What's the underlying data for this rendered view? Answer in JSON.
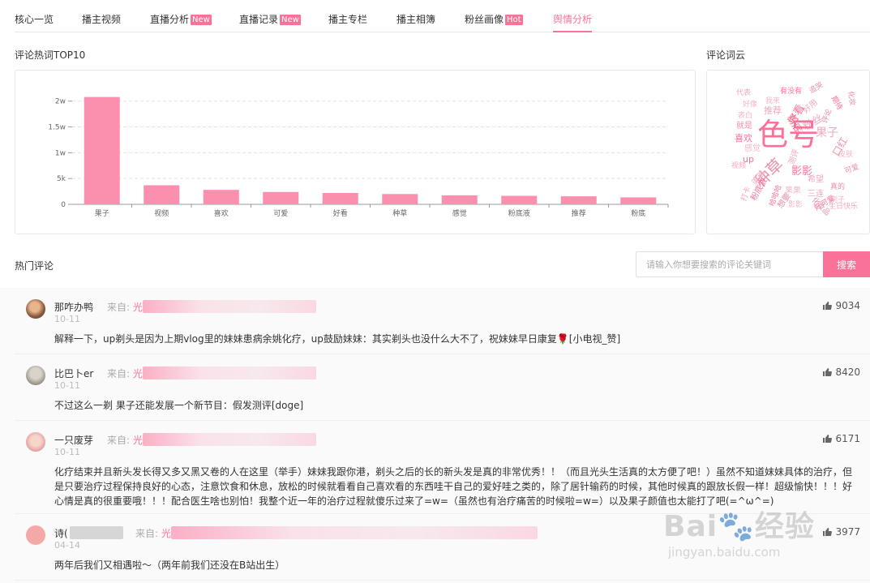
{
  "tabs": [
    {
      "label": "核心一览",
      "badge": ""
    },
    {
      "label": "播主视频",
      "badge": ""
    },
    {
      "label": "直播分析",
      "badge": "New"
    },
    {
      "label": "直播记录",
      "badge": "New"
    },
    {
      "label": "播主专栏",
      "badge": ""
    },
    {
      "label": "播主相簿",
      "badge": ""
    },
    {
      "label": "粉丝画像",
      "badge": "Hot"
    },
    {
      "label": "舆情分析",
      "badge": ""
    }
  ],
  "sections": {
    "top10": "评论热词TOP10",
    "cloud": "评论词云",
    "hot": "热门评论"
  },
  "chart_data": {
    "type": "bar",
    "title": "评论热词TOP10",
    "categories": [
      "果子",
      "视频",
      "喜欢",
      "可爱",
      "好看",
      "种草",
      "感觉",
      "粉底液",
      "推荐",
      "粉底"
    ],
    "values": [
      20800,
      3700,
      2800,
      2400,
      2200,
      2000,
      1750,
      1650,
      1550,
      1350
    ],
    "ylim": [
      0,
      22000
    ],
    "yticks": [
      0,
      5000,
      10000,
      15000,
      20000
    ],
    "ytick_labels": [
      "0",
      "5k",
      "1w",
      "1.5w",
      "2w"
    ],
    "grid": true,
    "colors": {
      "bar": "#fb8fae",
      "grid": "#e3e3e3",
      "axis": "#999"
    }
  },
  "word_cloud": [
    "代表",
    "有没有",
    "追哭",
    "我来",
    "好用",
    "期待",
    "化妆",
    "好像",
    "推荐",
    "好看",
    "评论",
    "表白",
    "粉丝",
    "粉底",
    "就是",
    "色号",
    "果子",
    "喜欢",
    "口红",
    "感觉",
    "测评",
    "up",
    "种草",
    "皮肤",
    "视频",
    "影影",
    "可爱",
    "弟弟",
    "希望",
    "粉底液",
    "真的",
    "果果",
    "三连",
    "哈哈哈",
    "想要",
    "刷子",
    "打卡",
    "好可爱",
    "化妆品",
    "影影",
    "生日快乐"
  ],
  "search": {
    "placeholder": "请输入你想要搜索的评论关键词",
    "button": "搜索"
  },
  "comments": [
    {
      "user": "那咋办鸭",
      "from_label": "来自:",
      "from_value": "光",
      "date": "10-11",
      "likes": "9034",
      "text": "解释一下，up剃头是因为上期vlog里的妹妹患病余姚化疗，up鼓励妹妹：其实剃头也没什么大不了，祝妹妹早日康复🌹[小电视_赞]"
    },
    {
      "user": "比巴卜er",
      "from_label": "来自:",
      "from_value": "光",
      "date": "10-11",
      "likes": "8420",
      "text": "不过这么一剃 果子还能发展一个新节目：假发测评[doge]"
    },
    {
      "user": "一只废芽",
      "from_label": "来自:",
      "from_value": "光",
      "date": "10-11",
      "likes": "6171",
      "text": "化疗结束并且新头发长得又多又黑又卷的人在这里（举手）妹妹我跟你港，剃头之后的长的新头发是真的非常优秀！！（而且光头生活真的太方便了吧！）虽然不知道妹妹具体的治疗，但是只要治疗过程保持良好的心态，注意饮食和休息，放松的时候就看看自己喜欢看的东西哇干自己的爱好哇之类的，除了居针输药的时候，其他时候真的跟放长假一样！超级愉快！！！好心情是真的很重要哦！！！配合医生啥也别怕！我整个近一年的治疗过程就傻乐过来了=w=（虽然也有治疗痛苦的时候啦=w=）以及果子颜值也太能打了吧(=^ω^=)"
    },
    {
      "user": "诗(",
      "from_label": "来自:",
      "from_value": "光",
      "date": "04-14",
      "likes": "3977",
      "text": "两年后我们又相遇啦～（两年前我们还没在B站出生）"
    }
  ],
  "watermark": {
    "main": "Bai🐾经验",
    "sub": "jingyan.baidu.com"
  }
}
